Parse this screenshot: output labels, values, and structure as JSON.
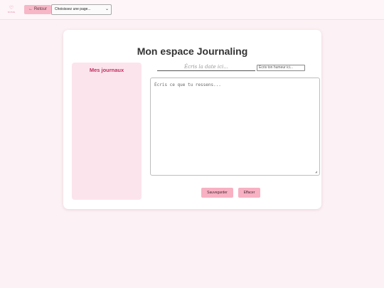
{
  "header": {
    "logo_text": "ROSIE",
    "back_label": "← Retour",
    "page_select_value": "Choisissez une page..."
  },
  "journal": {
    "title": "Mon espace Journaling",
    "sidebar_title": "Mes journaux",
    "date_placeholder": "Écris la date ici...",
    "mood_placeholder": "Écris ton humeur ici...",
    "entry_placeholder": "Écris ce que tu ressens...",
    "save_label": "Sauvegarder",
    "clear_label": "Effacer"
  },
  "colors": {
    "accent": "#f7b1c3",
    "sidebar_bg": "#fce4ec",
    "sidebar_title": "#c22f63",
    "page_bg": "#fcf2f5"
  }
}
